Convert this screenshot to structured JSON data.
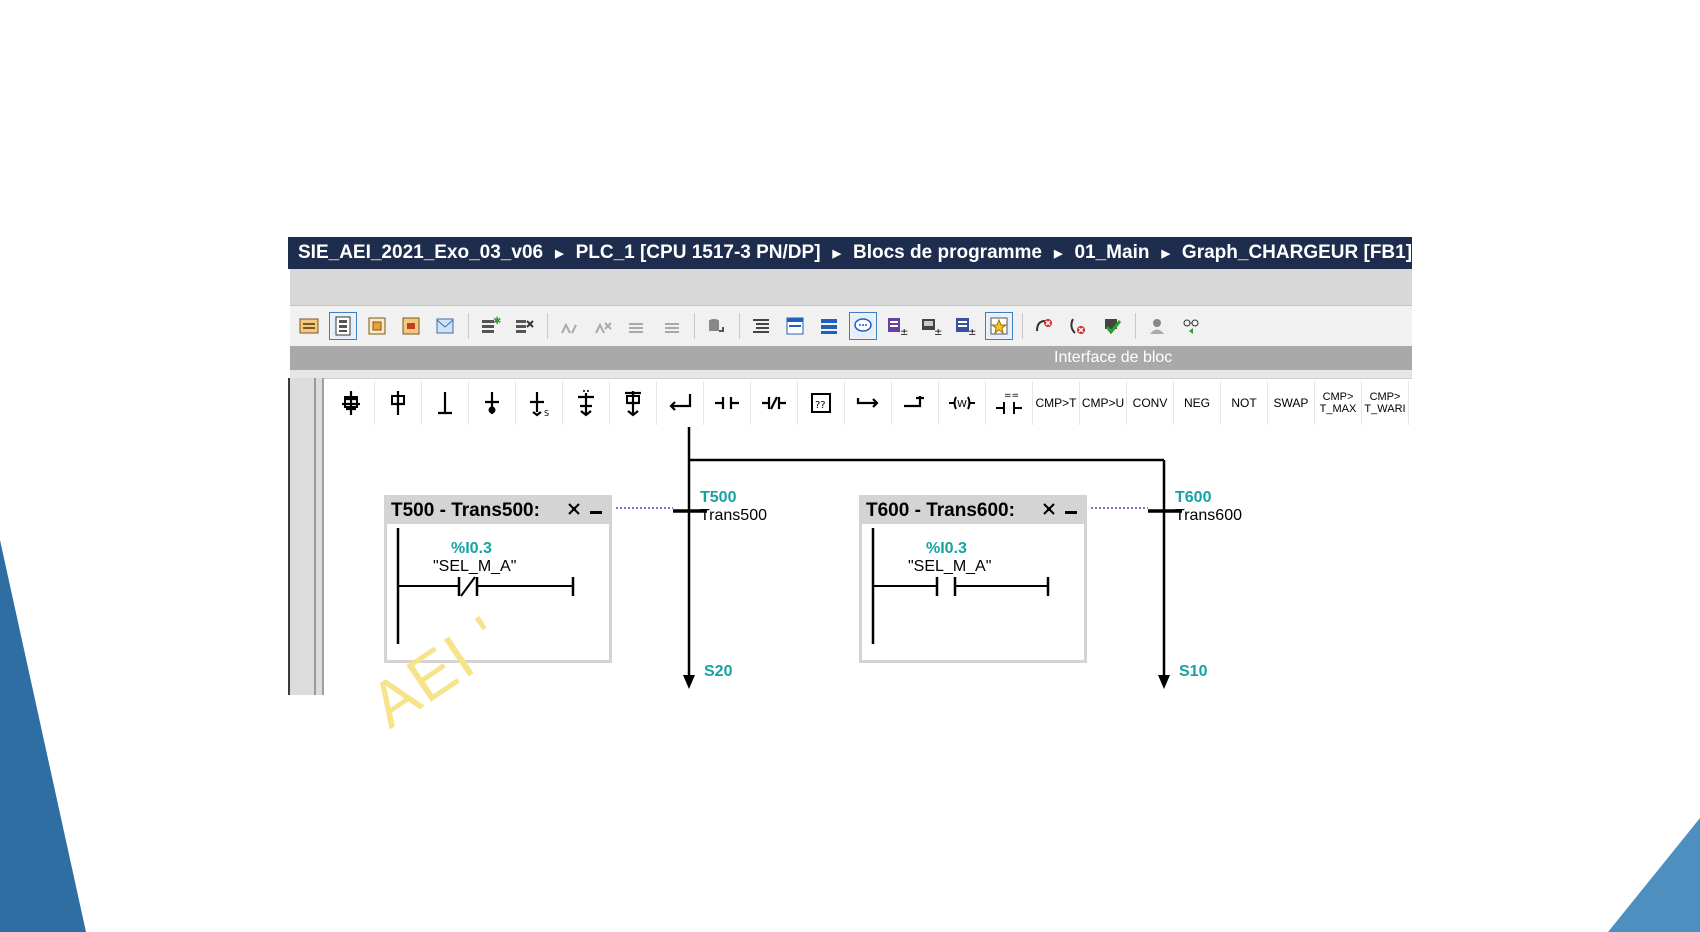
{
  "breadcrumb": {
    "items": [
      "SIE_AEI_2021_Exo_03_v06",
      "PLC_1 [CPU 1517-3 PN/DP]",
      "Blocs de programme",
      "01_Main",
      "Graph_CHARGEUR [FB1]"
    ]
  },
  "interface_bar": {
    "label": "Interface de bloc"
  },
  "instruction_bar": {
    "text_buttons": {
      "cmp_t": "CMP>T",
      "cmp_u": "CMP>U",
      "conv": "CONV",
      "neg": "NEG",
      "not": "NOT",
      "swap": "SWAP",
      "cmp_tmax_a": "CMP>",
      "cmp_tmax_b": "T_MAX",
      "cmp_twarn_a": "CMP>",
      "cmp_twarn_b": "T_WARI"
    }
  },
  "transitions": [
    {
      "header": "T500 - Trans500:",
      "address": "%I0.3",
      "variable": "\"SEL_M_A\"",
      "contact": "normally-closed",
      "trans_id": "T500",
      "trans_name": "Trans500",
      "next_step": "S20"
    },
    {
      "header": "T600 - Trans600:",
      "address": "%I0.3",
      "variable": "\"SEL_M_A\"",
      "contact": "normally-open",
      "trans_id": "T600",
      "trans_name": "Trans600",
      "next_step": "S10"
    }
  ],
  "watermark": "AEI '",
  "colors": {
    "breadcrumb_bg": "#1e2d4d",
    "accent_teal": "#17a2a2",
    "slide_blue": "#2f6ea3",
    "watermark": "#f6e38a"
  },
  "icons": {
    "toolbar": [
      "block-icon",
      "ladder-view-icon",
      "sequence-icon",
      "single-step-icon",
      "message-icon",
      "insert-network-icon",
      "delete-network-icon",
      "open-all-icon",
      "close-all-icon",
      "goto-first-icon",
      "goto-last-icon",
      "db-icon",
      "comment-icon",
      "compact-view-icon",
      "list-view-icon",
      "detail-view-icon",
      "speech-bubble-icon",
      "zoom-in-icon",
      "monitor-icon",
      "compare-icon",
      "favorites-icon",
      "error-icon",
      "acknowledge-icon",
      "check-icon",
      "user-icon",
      "glasses-icon"
    ]
  }
}
